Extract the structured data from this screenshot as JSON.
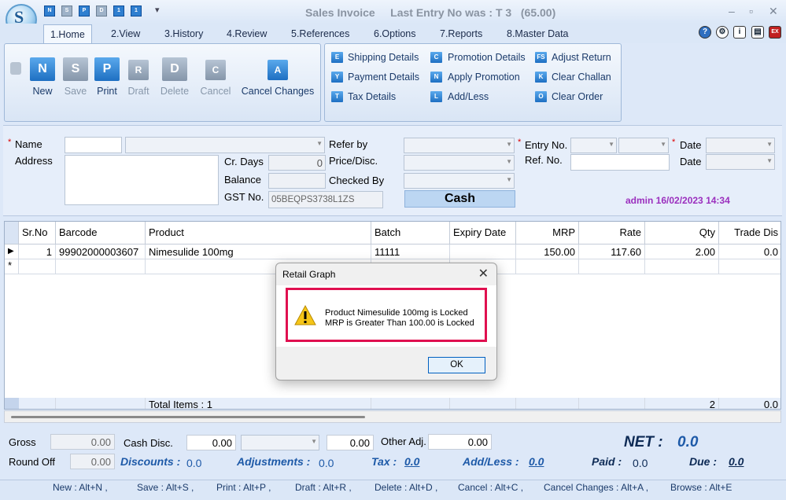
{
  "window": {
    "title": "Sales Invoice",
    "last_entry": "Last Entry No was : T 3",
    "last_amount": "(65.00)",
    "logo_letter": "S",
    "quick_access": [
      "N",
      "S",
      "P",
      "D",
      "1",
      "1"
    ]
  },
  "tabs": [
    "1.Home",
    "2.View",
    "3.History",
    "4.Review",
    "5.References",
    "6.Options",
    "7.Reports",
    "8.Master Data"
  ],
  "ribbon": {
    "buttons": [
      {
        "label": "New",
        "glyph": "N",
        "enabled": true
      },
      {
        "label": "Save",
        "glyph": "S",
        "enabled": false
      },
      {
        "label": "Print",
        "glyph": "P",
        "enabled": true
      },
      {
        "label": "Draft",
        "glyph": "R",
        "enabled": false
      },
      {
        "label": "Delete",
        "glyph": "D",
        "enabled": false
      },
      {
        "label": "Cancel",
        "glyph": "C",
        "enabled": false
      },
      {
        "label": "Cancel Changes",
        "glyph": "A",
        "enabled": true
      }
    ],
    "commands": [
      {
        "label": "Shipping Details",
        "glyph": "E"
      },
      {
        "label": "Payment Details",
        "glyph": "Y"
      },
      {
        "label": "Tax Details",
        "glyph": "T"
      },
      {
        "label": "Promotion Details",
        "glyph": "C"
      },
      {
        "label": "Apply Promotion",
        "glyph": "N"
      },
      {
        "label": "Add/Less",
        "glyph": "L"
      },
      {
        "label": "Adjust Return",
        "glyph": "FS"
      },
      {
        "label": "Clear Challan",
        "glyph": "K"
      },
      {
        "label": "Clear Order",
        "glyph": "O"
      }
    ]
  },
  "form": {
    "name_label": "Name",
    "address_label": "Address",
    "cr_days_label": "Cr. Days",
    "cr_days_value": "0",
    "balance_label": "Balance",
    "gst_label": "GST No.",
    "gst_value": "05BEQPS3738L1ZS",
    "refer_by_label": "Refer by",
    "price_disc_label": "Price/Disc.",
    "checked_by_label": "Checked By",
    "cash_label": "Cash",
    "entry_no_label": "Entry No.",
    "ref_no_label": "Ref. No.",
    "date_label": "Date",
    "date2_label": "Date",
    "user_stamp": "admin 16/02/2023 14:34"
  },
  "grid": {
    "columns": [
      "Sr.No",
      "Barcode",
      "Product",
      "Batch",
      "Expiry Date",
      "MRP",
      "Rate",
      "Qty",
      "Trade Dis"
    ],
    "rows": [
      {
        "sr": "1",
        "barcode": "99902000003607",
        "product": "Nimesulide 100mg",
        "batch": "11111",
        "expiry": "",
        "mrp": "150.00",
        "rate": "117.60",
        "qty": "2.00",
        "trade": "0.0"
      }
    ],
    "new_row_marker": "*",
    "current_row_marker": "▶",
    "total_items": "Total Items : 1",
    "total_qty": "2",
    "total_trade": "0.0"
  },
  "totals": {
    "gross_label": "Gross",
    "gross_value": "0.00",
    "round_off_label": "Round Off",
    "round_off_value": "0.00",
    "cash_disc_label": "Cash Disc.",
    "cash_disc_value": "0.00",
    "cash_disc_value2": "0.00",
    "other_adj_label": "Other Adj.",
    "other_adj_value": "0.00",
    "net_label": "NET :",
    "net_value": "0.0",
    "discounts_label": "Discounts :",
    "discounts_value": "0.0",
    "adjustments_label": "Adjustments :",
    "adjustments_value": "0.0",
    "tax_label": "Tax :",
    "tax_value": "0.0",
    "addless_label": "Add/Less :",
    "addless_value": "0.0",
    "paid_label": "Paid :",
    "paid_value": "0.0",
    "due_label": "Due :",
    "due_value": "0.0"
  },
  "shortcuts": [
    "New : Alt+N ,",
    "Save : Alt+S ,",
    "Print : Alt+P ,",
    "Draft : Alt+R ,",
    "Delete : Alt+D ,",
    "Cancel : Alt+C ,",
    "Cancel Changes : Alt+A ,",
    "Browse : Alt+E"
  ],
  "dialog": {
    "title": "Retail Graph",
    "line1": "Product Nimesulide 100mg  is Locked",
    "line2": "MRP is Greater Than 100.00 is Locked",
    "ok_label": "OK"
  },
  "colors": {
    "accent": "#1e6fc2",
    "highlight_border": "#e01050",
    "user_stamp": "#9b2fbe",
    "net": "#1e5aa8"
  }
}
